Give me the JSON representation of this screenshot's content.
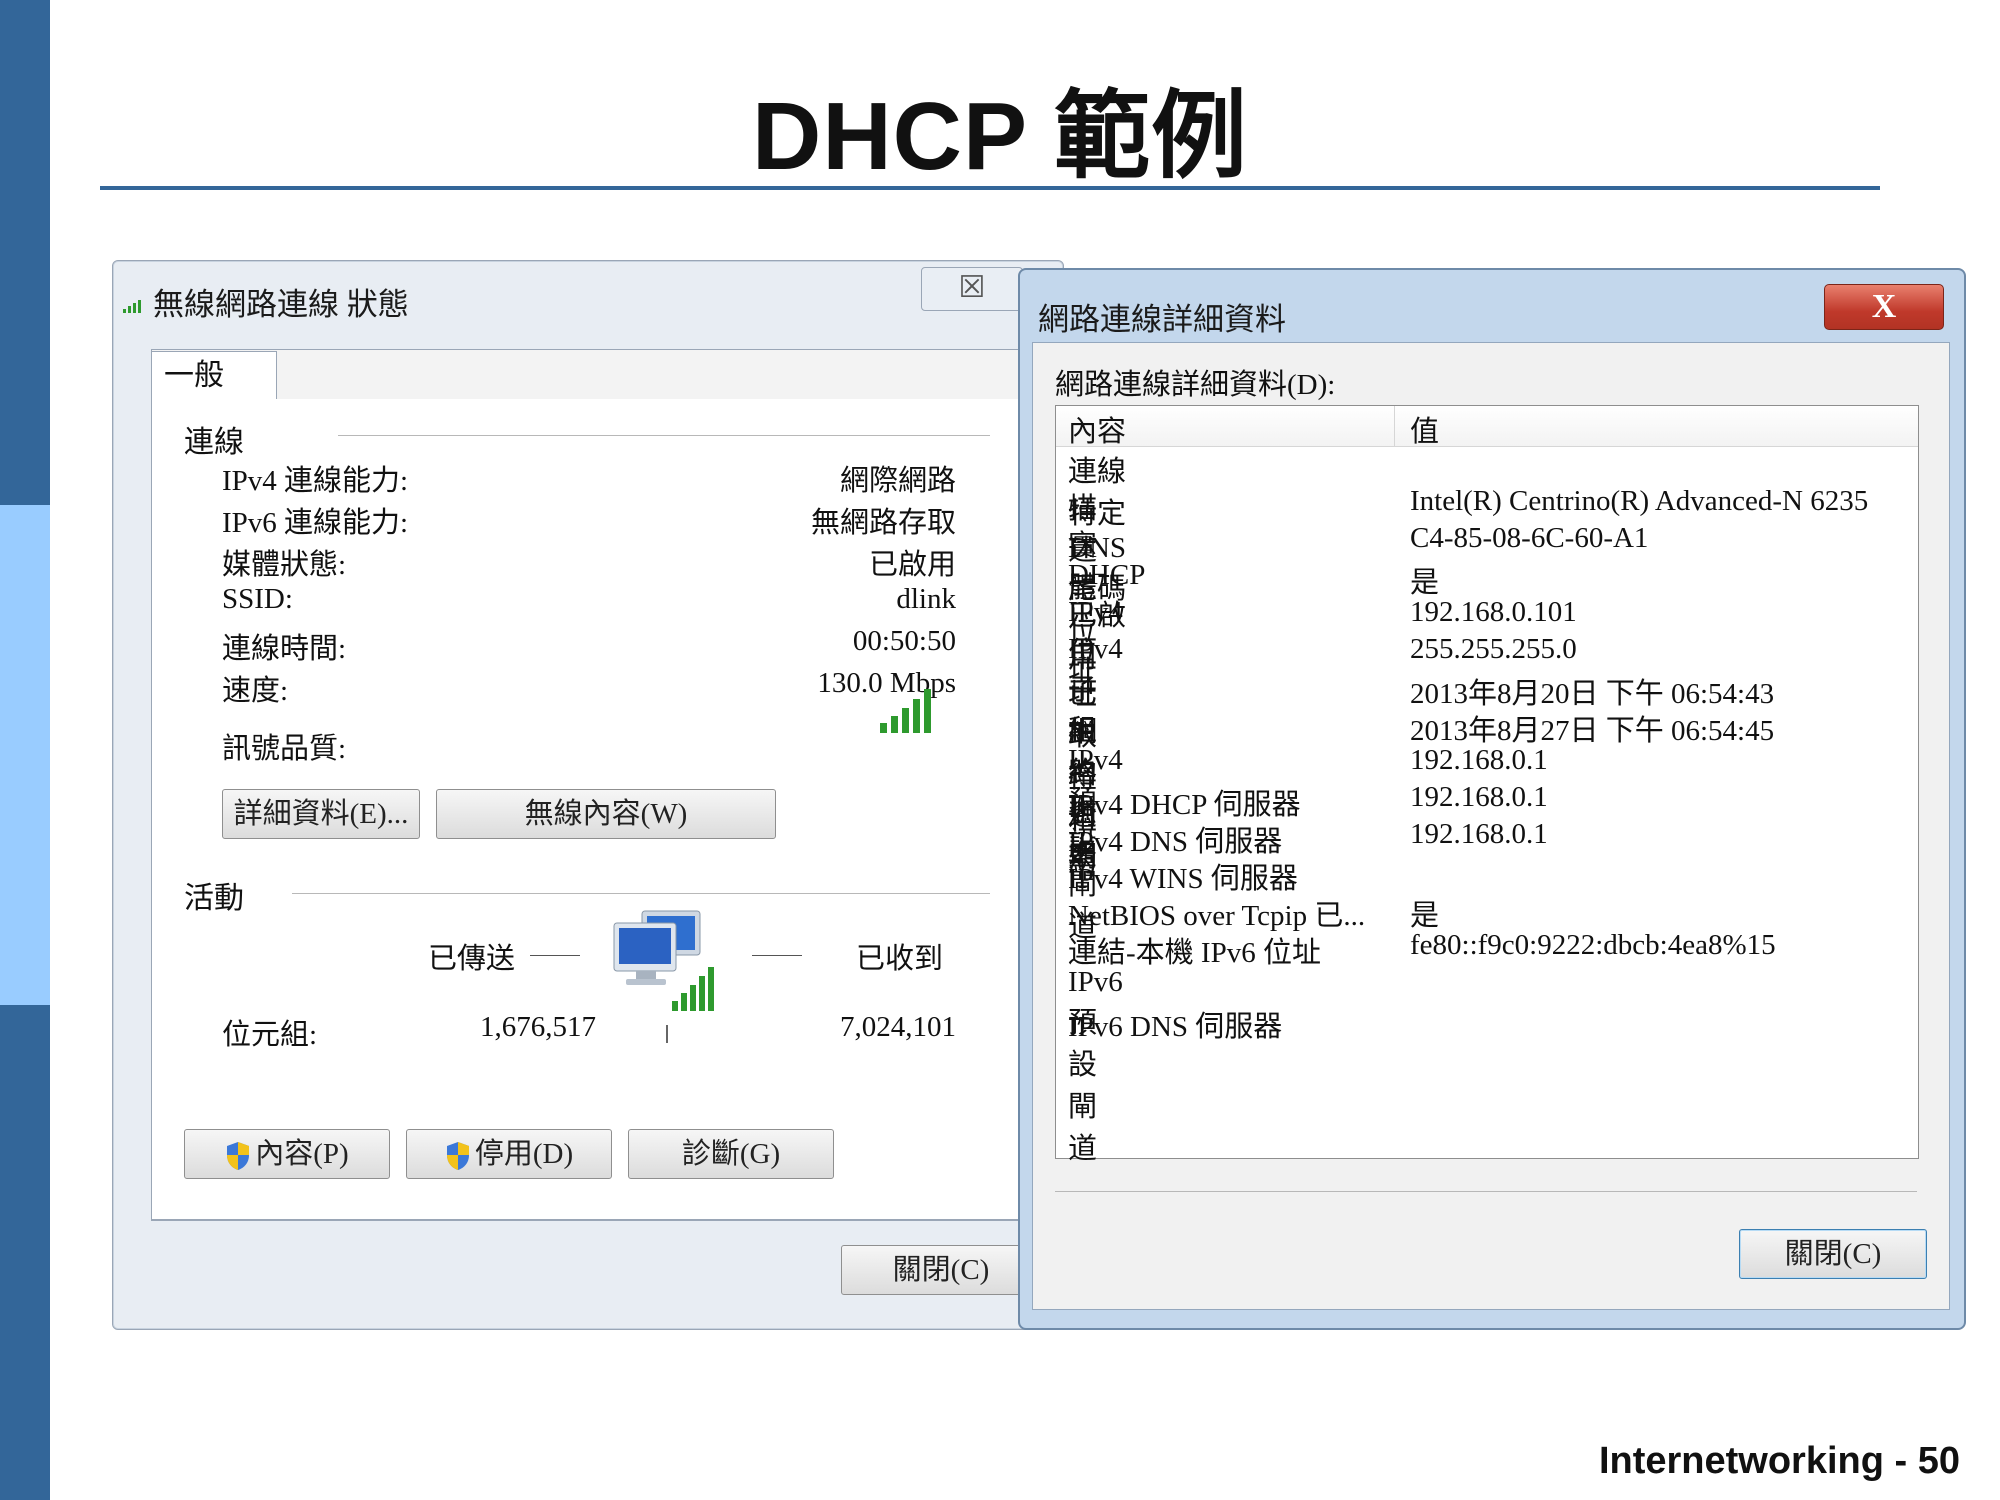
{
  "slide": {
    "title": "DHCP 範例",
    "footer": "Internetworking - 50"
  },
  "status_window": {
    "title": "無線網路連線 狀態",
    "close_glyph": "☒",
    "tab_general": "一般",
    "group_connection": "連線",
    "rows": [
      {
        "label": "IPv4 連線能力:",
        "value": "網際網路"
      },
      {
        "label": "IPv6 連線能力:",
        "value": "無網路存取"
      },
      {
        "label": "媒體狀態:",
        "value": "已啟用"
      },
      {
        "label": "SSID:",
        "value": "dlink"
      },
      {
        "label": "連線時間:",
        "value": "00:50:50"
      },
      {
        "label": "速度:",
        "value": "130.0 Mbps"
      }
    ],
    "signal_label": "訊號品質:",
    "signal_bars": 5,
    "details_button": "詳細資料(E)...",
    "wireless_props_button": "無線內容(W)",
    "group_activity": "活動",
    "sent_label": "已傳送",
    "received_label": "已收到",
    "bytes_label": "位元組:",
    "bytes_sent": "1,676,517",
    "bytes_received": "7,024,101",
    "properties_button": "內容(P)",
    "disable_button": "停用(D)",
    "diagnose_button": "診斷(G)",
    "close_button": "關閉(C)"
  },
  "details_window": {
    "title": "網路連線詳細資料",
    "close_glyph": "X",
    "list_label": "網路連線詳細資料(D):",
    "col_property": "內容",
    "col_value": "值",
    "rows": [
      {
        "property": "連線特定 DNS 尾碼",
        "value": ""
      },
      {
        "property": "描述",
        "value": "Intel(R) Centrino(R) Advanced-N 6235"
      },
      {
        "property": "實體位址",
        "value": "C4-85-08-6C-60-A1"
      },
      {
        "property": "DHCP 已啟用",
        "value": "是"
      },
      {
        "property": "IPv4 位址",
        "value": "192.168.0.101"
      },
      {
        "property": "IPv4 子網路遮罩",
        "value": "255.255.255.0"
      },
      {
        "property": "已取得租約",
        "value": "2013年8月20日 下午 06:54:43"
      },
      {
        "property": "租約到期",
        "value": "2013年8月27日 下午 06:54:45"
      },
      {
        "property": "IPv4 預設閘道",
        "value": "192.168.0.1"
      },
      {
        "property": "IPv4 DHCP 伺服器",
        "value": "192.168.0.1"
      },
      {
        "property": "IPv4 DNS 伺服器",
        "value": "192.168.0.1"
      },
      {
        "property": "IPv4 WINS 伺服器",
        "value": ""
      },
      {
        "property": "NetBIOS over Tcpip 已...",
        "value": "是"
      },
      {
        "property": "連結-本機 IPv6 位址",
        "value": "fe80::f9c0:9222:dbcb:4ea8%15"
      },
      {
        "property": "IPv6 預設閘道",
        "value": ""
      },
      {
        "property": "IPv6 DNS 伺服器",
        "value": ""
      }
    ],
    "close_button": "關閉(C)"
  },
  "colors": {
    "slide_bar": "#336699",
    "slide_bar_light": "#99ccff",
    "signal_green": "#2e9a2e",
    "close_red": "#c0392b"
  }
}
